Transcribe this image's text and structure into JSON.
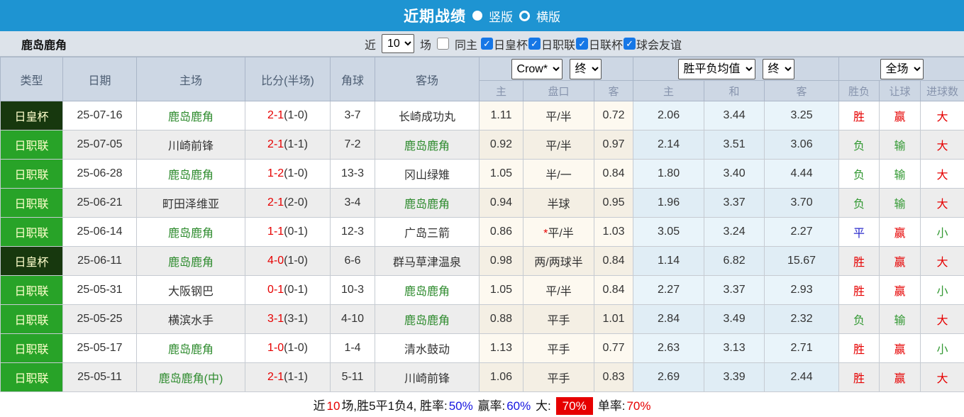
{
  "titlebar": {
    "title": "近期战绩",
    "radio_vertical": "竖版",
    "radio_horizontal": "横版",
    "selected": "竖版"
  },
  "filter": {
    "team": "鹿岛鹿角",
    "recent_label": "近",
    "recent_value": "10",
    "matches_label": "场",
    "same_home": {
      "label": "同主",
      "checked": false
    },
    "competitions": [
      {
        "label": "日皇杯",
        "checked": true
      },
      {
        "label": "日职联",
        "checked": true
      },
      {
        "label": "日联杯",
        "checked": true
      },
      {
        "label": "球会友谊",
        "checked": true
      }
    ]
  },
  "table": {
    "main_headers": [
      "类型",
      "日期",
      "主场",
      "比分(半场)",
      "角球",
      "客场"
    ],
    "dropdowns": {
      "bookmaker": "Crow*",
      "bookmaker_time": "终",
      "avg": "胜平负均值",
      "avg_time": "终",
      "period": "全场"
    },
    "subheaders": [
      "主",
      "盘口",
      "客",
      "主",
      "和",
      "客",
      "胜负",
      "让球",
      "进球数"
    ],
    "rows": [
      {
        "type": "日皇杯",
        "type_style": "cup",
        "date": "25-07-16",
        "home": "鹿岛鹿角",
        "home_highlight": true,
        "score": "2-1",
        "half": "(1-0)",
        "corner": "3-7",
        "away": "长崎成功丸",
        "away_highlight": false,
        "odds_home": "1.11",
        "handicap": "平/半",
        "handicap_star": "",
        "odds_away": "0.72",
        "avg_home": "2.06",
        "avg_draw": "3.44",
        "avg_away": "3.25",
        "result": {
          "text": "胜",
          "color": "red"
        },
        "handicap_result": {
          "text": "赢",
          "color": "red"
        },
        "goals": {
          "text": "大",
          "color": "red"
        }
      },
      {
        "type": "日职联",
        "type_style": "league",
        "date": "25-07-05",
        "home": "川崎前锋",
        "home_highlight": false,
        "score": "2-1",
        "half": "(1-1)",
        "corner": "7-2",
        "away": "鹿岛鹿角",
        "away_highlight": true,
        "odds_home": "0.92",
        "handicap": "平/半",
        "handicap_star": "",
        "odds_away": "0.97",
        "avg_home": "2.14",
        "avg_draw": "3.51",
        "avg_away": "3.06",
        "result": {
          "text": "负",
          "color": "green"
        },
        "handicap_result": {
          "text": "输",
          "color": "green"
        },
        "goals": {
          "text": "大",
          "color": "red"
        }
      },
      {
        "type": "日职联",
        "type_style": "league",
        "date": "25-06-28",
        "home": "鹿岛鹿角",
        "home_highlight": true,
        "score": "1-2",
        "half": "(1-0)",
        "corner": "13-3",
        "away": "冈山绿雉",
        "away_highlight": false,
        "odds_home": "1.05",
        "handicap": "半/一",
        "handicap_star": "",
        "odds_away": "0.84",
        "avg_home": "1.80",
        "avg_draw": "3.40",
        "avg_away": "4.44",
        "result": {
          "text": "负",
          "color": "green"
        },
        "handicap_result": {
          "text": "输",
          "color": "green"
        },
        "goals": {
          "text": "大",
          "color": "red"
        }
      },
      {
        "type": "日职联",
        "type_style": "league",
        "date": "25-06-21",
        "home": "町田泽维亚",
        "home_highlight": false,
        "score": "2-1",
        "half": "(2-0)",
        "corner": "3-4",
        "away": "鹿岛鹿角",
        "away_highlight": true,
        "odds_home": "0.94",
        "handicap": "半球",
        "handicap_star": "",
        "odds_away": "0.95",
        "avg_home": "1.96",
        "avg_draw": "3.37",
        "avg_away": "3.70",
        "result": {
          "text": "负",
          "color": "green"
        },
        "handicap_result": {
          "text": "输",
          "color": "green"
        },
        "goals": {
          "text": "大",
          "color": "red"
        }
      },
      {
        "type": "日职联",
        "type_style": "league",
        "date": "25-06-14",
        "home": "鹿岛鹿角",
        "home_highlight": true,
        "score": "1-1",
        "half": "(0-1)",
        "corner": "12-3",
        "away": "广岛三箭",
        "away_highlight": false,
        "odds_home": "0.86",
        "handicap": "平/半",
        "handicap_star": "*",
        "odds_away": "1.03",
        "avg_home": "3.05",
        "avg_draw": "3.24",
        "avg_away": "2.27",
        "result": {
          "text": "平",
          "color": "blue"
        },
        "handicap_result": {
          "text": "赢",
          "color": "red"
        },
        "goals": {
          "text": "小",
          "color": "green"
        }
      },
      {
        "type": "日皇杯",
        "type_style": "cup",
        "date": "25-06-11",
        "home": "鹿岛鹿角",
        "home_highlight": true,
        "score": "4-0",
        "half": "(1-0)",
        "corner": "6-6",
        "away": "群马草津温泉",
        "away_highlight": false,
        "odds_home": "0.98",
        "handicap": "两/两球半",
        "handicap_star": "",
        "odds_away": "0.84",
        "avg_home": "1.14",
        "avg_draw": "6.82",
        "avg_away": "15.67",
        "result": {
          "text": "胜",
          "color": "red"
        },
        "handicap_result": {
          "text": "赢",
          "color": "red"
        },
        "goals": {
          "text": "大",
          "color": "red"
        }
      },
      {
        "type": "日职联",
        "type_style": "league",
        "date": "25-05-31",
        "home": "大阪钢巴",
        "home_highlight": false,
        "score": "0-1",
        "half": "(0-1)",
        "corner": "10-3",
        "away": "鹿岛鹿角",
        "away_highlight": true,
        "odds_home": "1.05",
        "handicap": "平/半",
        "handicap_star": "",
        "odds_away": "0.84",
        "avg_home": "2.27",
        "avg_draw": "3.37",
        "avg_away": "2.93",
        "result": {
          "text": "胜",
          "color": "red"
        },
        "handicap_result": {
          "text": "赢",
          "color": "red"
        },
        "goals": {
          "text": "小",
          "color": "green"
        }
      },
      {
        "type": "日职联",
        "type_style": "league",
        "date": "25-05-25",
        "home": "横滨水手",
        "home_highlight": false,
        "score": "3-1",
        "half": "(3-1)",
        "corner": "4-10",
        "away": "鹿岛鹿角",
        "away_highlight": true,
        "odds_home": "0.88",
        "handicap": "平手",
        "handicap_star": "",
        "odds_away": "1.01",
        "avg_home": "2.84",
        "avg_draw": "3.49",
        "avg_away": "2.32",
        "result": {
          "text": "负",
          "color": "green"
        },
        "handicap_result": {
          "text": "输",
          "color": "green"
        },
        "goals": {
          "text": "大",
          "color": "red"
        }
      },
      {
        "type": "日职联",
        "type_style": "league",
        "date": "25-05-17",
        "home": "鹿岛鹿角",
        "home_highlight": true,
        "score": "1-0",
        "half": "(1-0)",
        "corner": "1-4",
        "away": "清水鼓动",
        "away_highlight": false,
        "odds_home": "1.13",
        "handicap": "平手",
        "handicap_star": "",
        "odds_away": "0.77",
        "avg_home": "2.63",
        "avg_draw": "3.13",
        "avg_away": "2.71",
        "result": {
          "text": "胜",
          "color": "red"
        },
        "handicap_result": {
          "text": "赢",
          "color": "red"
        },
        "goals": {
          "text": "小",
          "color": "green"
        }
      },
      {
        "type": "日职联",
        "type_style": "league",
        "date": "25-05-11",
        "home": "鹿岛鹿角(中)",
        "home_highlight": true,
        "score": "2-1",
        "half": "(1-1)",
        "corner": "5-11",
        "away": "川崎前锋",
        "away_highlight": false,
        "odds_home": "1.06",
        "handicap": "平手",
        "handicap_star": "",
        "odds_away": "0.83",
        "avg_home": "2.69",
        "avg_draw": "3.39",
        "avg_away": "2.44",
        "result": {
          "text": "胜",
          "color": "red"
        },
        "handicap_result": {
          "text": "赢",
          "color": "red"
        },
        "goals": {
          "text": "大",
          "color": "red"
        }
      }
    ]
  },
  "summary": {
    "parts": [
      {
        "text": "近",
        "color": "black"
      },
      {
        "text": "10",
        "color": "red"
      },
      {
        "text": "场,胜5平1负4, 胜率:",
        "color": "black"
      },
      {
        "text": "50%",
        "color": "blue"
      },
      {
        "text": " 赢率:",
        "color": "black"
      },
      {
        "text": "60%",
        "color": "blue"
      },
      {
        "text": " 大:",
        "color": "black"
      },
      {
        "text": "70%",
        "color": "white",
        "bg": "red"
      },
      {
        "text": "单率:",
        "color": "black"
      },
      {
        "text": "70%",
        "color": "red"
      }
    ]
  },
  "colors": {
    "header_blue": "#1e94d2",
    "league_green": "#28a328",
    "cup_dark_green": "#17380e",
    "win_red": "#e60000",
    "lose_green": "#339933",
    "draw_blue": "#2a2acc",
    "team_green": "#2e8b2e",
    "rate_blue": "#1515e0",
    "checkbox_blue": "#1677e6"
  }
}
